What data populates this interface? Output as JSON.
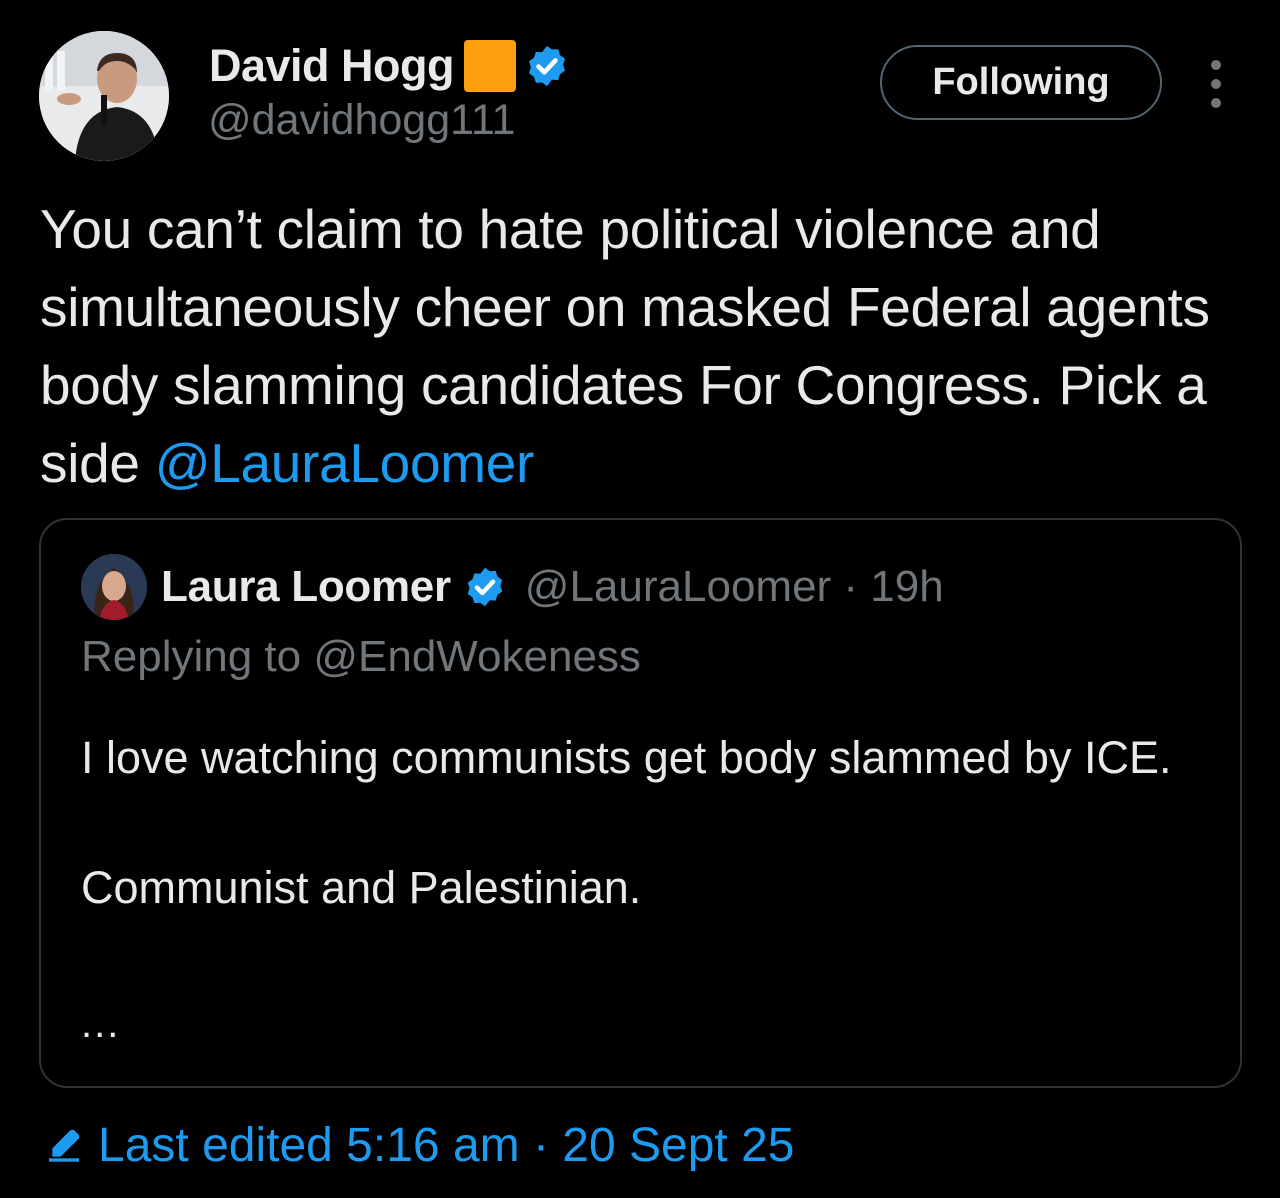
{
  "tweet": {
    "author": {
      "name": "David Hogg",
      "handle": "@davidhogg111",
      "name_emoji_color": "#ff9e0f",
      "verified_color": "#1d9bf0",
      "avatar_icon": "avatar-photo-icon"
    },
    "follow_button_label": "Following",
    "more_icon": "more-vertical-icon",
    "text_main": "You can’t claim to hate political violence and simultaneously cheer on masked Federal agents body slamming candidates For Congress. Pick a side ",
    "text_mention": "@LauraLoomer",
    "quote": {
      "author_name": "Laura Loomer",
      "author_meta": "@LauraLoomer · 19h",
      "replying_to": "Replying to @EndWokeness",
      "body_line_1": "I love watching communists get body slammed by ICE.",
      "body_line_2": "Communist and Palestinian.",
      "ellipsis": "..."
    },
    "edited_label": "Last edited 5:16 am · 20 Sept 25",
    "edited_icon": "pencil-icon"
  },
  "colors": {
    "background": "#000000",
    "text_primary": "#e7e9ea",
    "text_secondary": "#71767b",
    "accent": "#1d9bf0",
    "border": "#2f3336"
  }
}
